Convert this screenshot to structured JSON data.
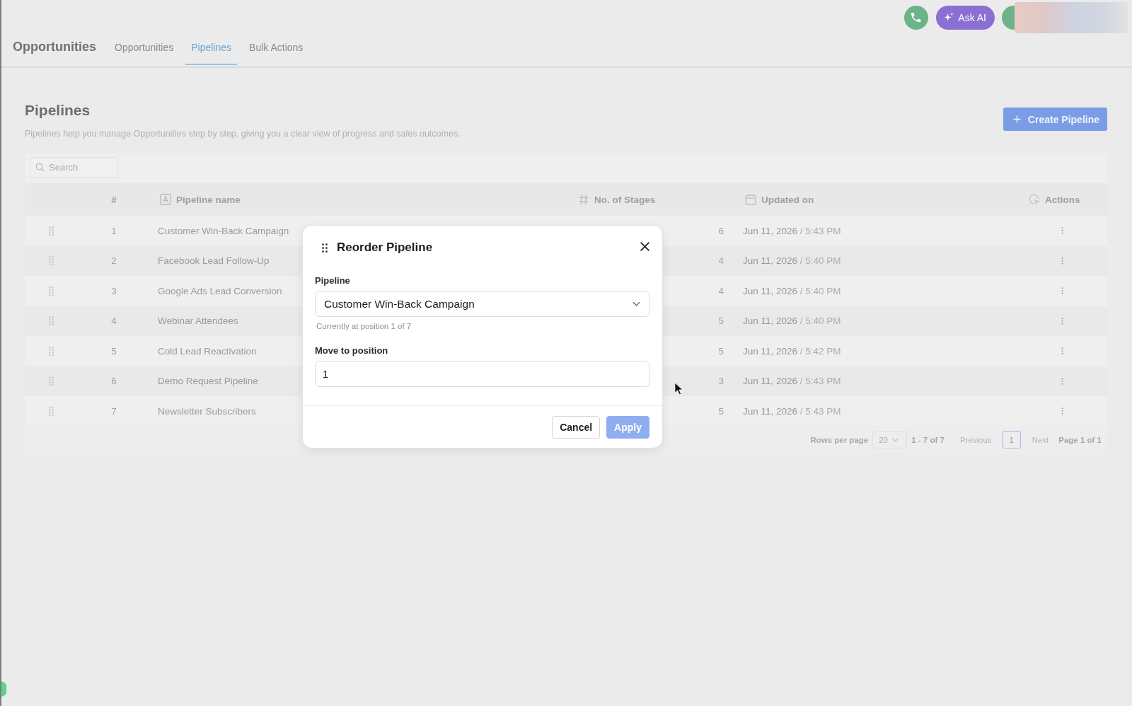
{
  "header": {
    "title": "Opportunities",
    "tabs": [
      {
        "label": "Opportunities",
        "selected": false
      },
      {
        "label": "Pipelines",
        "selected": true
      },
      {
        "label": "Bulk Actions",
        "selected": false
      }
    ]
  },
  "top_actions": {
    "ask_ai": "Ask AI"
  },
  "page": {
    "title": "Pipelines",
    "description": "Pipelines help you manage Opportunities step by step, giving you a clear view of progress and sales outcomes.",
    "create_button": "Create Pipeline"
  },
  "table": {
    "search": {
      "placeholder": "Search"
    },
    "columns": [
      {
        "label": "#",
        "kind": "index"
      },
      {
        "label": "Pipeline name",
        "kind": "text"
      },
      {
        "label": "No. of Stages",
        "kind": "number"
      },
      {
        "label": "Updated on",
        "kind": "date"
      },
      {
        "label": "Actions",
        "kind": "actions"
      }
    ],
    "rows": [
      {
        "index": "1",
        "name": "Customer Win-Back Campaign",
        "stages": "6",
        "updated_date": "Jun 11, 2026",
        "updated_time": "/ 5:43 PM"
      },
      {
        "index": "2",
        "name": "Facebook Lead Follow-Up",
        "stages": "4",
        "updated_date": "Jun 11, 2026",
        "updated_time": "/ 5:40 PM"
      },
      {
        "index": "3",
        "name": "Google Ads Lead Conversion",
        "stages": "4",
        "updated_date": "Jun 11, 2026",
        "updated_time": "/ 5:40 PM"
      },
      {
        "index": "4",
        "name": "Webinar Attendees",
        "stages": "5",
        "updated_date": "Jun 11, 2026",
        "updated_time": "/ 5:40 PM"
      },
      {
        "index": "5",
        "name": "Cold Lead Reactivation",
        "stages": "5",
        "updated_date": "Jun 11, 2026",
        "updated_time": "/ 5:42 PM"
      },
      {
        "index": "6",
        "name": "Demo Request Pipeline",
        "stages": "3",
        "updated_date": "Jun 11, 2026",
        "updated_time": "/ 5:43 PM"
      },
      {
        "index": "7",
        "name": "Newsletter Subscribers",
        "stages": "5",
        "updated_date": "Jun 11, 2026",
        "updated_time": "/ 5:43 PM"
      }
    ]
  },
  "pagination": {
    "rows_per_page_label": "Rows per page",
    "rows_per_page": "20",
    "range": "1 - 7 of 7",
    "previous": {
      "label": "Previous",
      "disabled": true
    },
    "pages": [
      {
        "label": "1",
        "selected": true
      }
    ],
    "next": {
      "label": "Next",
      "disabled": true
    },
    "page_info": "Page 1 of 1"
  },
  "dialog": {
    "title": "Reorder Pipeline",
    "pipeline_label": "Pipeline",
    "pipeline_value": "Customer Win-Back Campaign",
    "hint": "Currently at position 1 of 7",
    "position_label": "Move to position",
    "position_value": "1",
    "buttons": [
      {
        "label": "Cancel",
        "kind": "secondary",
        "disabled": false
      },
      {
        "label": "Apply",
        "kind": "primary",
        "disabled": true
      }
    ]
  }
}
